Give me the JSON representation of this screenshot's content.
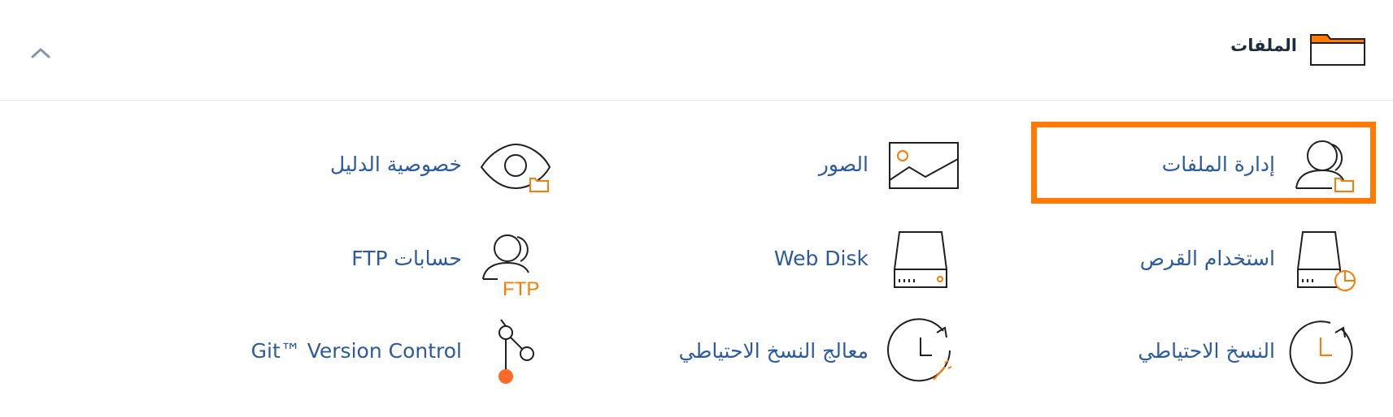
{
  "section": {
    "title": "الملفات",
    "icon": "folder-icon",
    "collapse_icon": "chevron-up-icon"
  },
  "colors": {
    "accent": "#ff7a00",
    "link": "#2b5a9e",
    "icon_stroke": "#1f1f1f"
  },
  "items": [
    {
      "label": "إدارة الملفات",
      "icon": "user-folder-icon",
      "highlighted": true
    },
    {
      "label": "الصور",
      "icon": "image-icon"
    },
    {
      "label": "خصوصية الدليل",
      "icon": "eye-folder-icon"
    },
    {
      "label": "استخدام القرص",
      "icon": "disk-usage-icon"
    },
    {
      "label": "Web Disk",
      "icon": "hard-drive-icon"
    },
    {
      "label": "حسابات FTP",
      "icon": "ftp-user-icon",
      "icon_text": "FTP"
    },
    {
      "label": "النسخ الاحتياطي",
      "icon": "backup-clock-icon"
    },
    {
      "label": "معالج النسخ الاحتياطي",
      "icon": "backup-wizard-icon"
    },
    {
      "label": "Git™ Version Control",
      "icon": "git-branch-icon"
    }
  ]
}
